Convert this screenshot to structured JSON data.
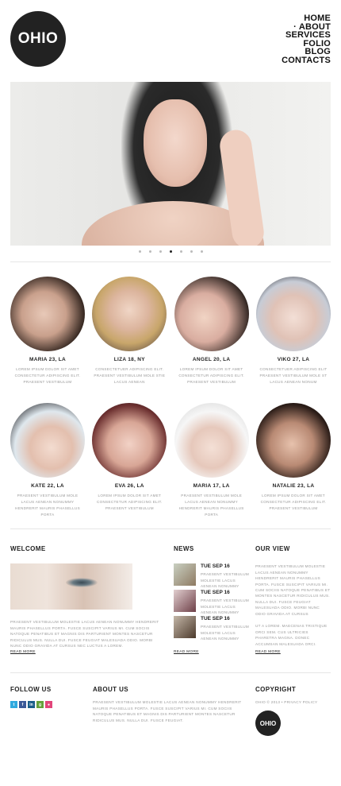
{
  "logo": "OHIO",
  "nav": [
    "HOME",
    "· ABOUT",
    "SERVICES",
    "FOLIO",
    "BLOG",
    "CONTACTS"
  ],
  "slider": {
    "dots": 7,
    "active_index": 3
  },
  "models_row1": [
    {
      "name": "MARIA 23, LA",
      "text": "LOREM IPSUM DOLOR SIT AMET CONSECTETUR ADIPISCING ELIT. PRAESENT VESTIBULUM"
    },
    {
      "name": "LIZA 18, NY",
      "text": "CONSECTETUER ADIPISCING ELIT. PRAESENT VESTIBULUM MOLE STIE LACUS AENEAN"
    },
    {
      "name": "ANGEL 20, LA",
      "text": "LOREM IPSUM DOLOR SIT AMET CONSECTETUR ADIPISCING ELIT. PRAESENT VESTIBULUM"
    },
    {
      "name": "VIKO 27, LA",
      "text": "CONSECTETUER ADIPISCING ELIT PRAESENT VESTIBULUM MOLE ST LACUS AENEAN NONUM"
    }
  ],
  "models_row2": [
    {
      "name": "KATE 22, LA",
      "text": "PRAESENT VESTIBULUM MOLE LACUS AENEAN NONUMMY HENDRERIT MAURIS PHASELLUS PORTA"
    },
    {
      "name": "EVA 26, LA",
      "text": "LOREM IPSUM DOLOR SIT AMET CONSECTETUR ADIPISCING ELIT. PRAESENT VESTIBULUM"
    },
    {
      "name": "MARIA 17, LA",
      "text": "PRAESENT VESTIBULUM MOLE LACUS AENEAN NONUMMY HENDRERIT MAURIS PHASELLUS PORTA"
    },
    {
      "name": "NATALIE 23, LA",
      "text": "LOREM IPSUM DOLOR SIT AMET CONSECTETUR ADIPISCING ELIT. PRAESENT VESTIBULUM"
    }
  ],
  "welcome": {
    "title": "WELCOME",
    "text": "PRAESENT VESTIBULUM MOLESTIE LACUS AENEAN NONUMMY HENDRERIT MAURIS PHASELLUS PORTA. FUSCE SUSCIPIT VARIUS MI. CUM SOCIIS NATOQUE PENATIBUS ET MAGNIS DIS PARTURIENT MONTES NASCETUR RIDICULUS MUS. NULLA DUI. FUSCE FEUGIAT MALESUADA ODIO. MORBI NUNC ODIO GRAVIDA AT CURSUS NEC LUCTUS A LOREM.",
    "more": "READ MORE"
  },
  "news": {
    "title": "NEWS",
    "items": [
      {
        "date": "TUE SEP 16",
        "text": "PRAESENT VESTIBULUM MOLESTIE LACUS AENEAN NONUMMY"
      },
      {
        "date": "TUE SEP 16",
        "text": "PRAESENT VESTIBULUM MOLESTIE LACUS AENEAN NONUMMY"
      },
      {
        "date": "TUE SEP 16",
        "text": "PRAESENT VESTIBULUM MOLESTIE LACUS AENEAN NONUMMY"
      }
    ],
    "more": "READ MORE"
  },
  "ourview": {
    "title": "OUR VIEW",
    "p1": "PRAESENT VESTIBULUM MOLESTIE LACUS AENEAN NONUMMY HENDRERIT MAURIS PHASELLUS PORTA. FUSCE SUSCIPIT VARIUS MI. CUM SOCIIS NATOQUE PENATIBUS ET",
    "p2": "MONTES NASCETUR RIDICULUS MUS. NULLA DUI. FUSCE FEUGIAT MALESUADA ODIO. MORBI NUNC ODIO GRAVIDA AT CURSUS",
    "p3": "UT A LOREM. MAECENAS TRISTIQUE ORCI SEM. CUS ULTRICIES PHARETRA MAGNA. DONEC ACCUMSAN MALESUADA ORCI.",
    "more": "READ MORE"
  },
  "follow": {
    "title": "FOLLOW US",
    "icons": [
      "t",
      "f",
      "in",
      "g",
      "●"
    ]
  },
  "about": {
    "title": "ABOUT US",
    "text": "PRAESENT VESTIBULUM MOLESTIE LACUS AENEAN NONUMMY HENDRERIT MAURIS PHASELLUS PORTA. FUSCE SUSCIPIT VARIUS MI. CUM SOCIIS NATOQUE PENATIBUS ET MAGNIS DIS PARTURIENT MONTES NASCETUR RIDICULUS MUS. NULLA DUI. FUSCE FEUGIAT."
  },
  "copyright": {
    "title": "COPYRIGHT",
    "text": "OHIO © 2013 • PRIVACY POLICY",
    "logo": "OHIO"
  },
  "colors": {
    "dark": "#222222",
    "twitter": "#2fa9df",
    "facebook": "#3b5998",
    "linkedin": "#1a5e8a",
    "google": "#65a23b",
    "dribbble": "#e2457a"
  }
}
